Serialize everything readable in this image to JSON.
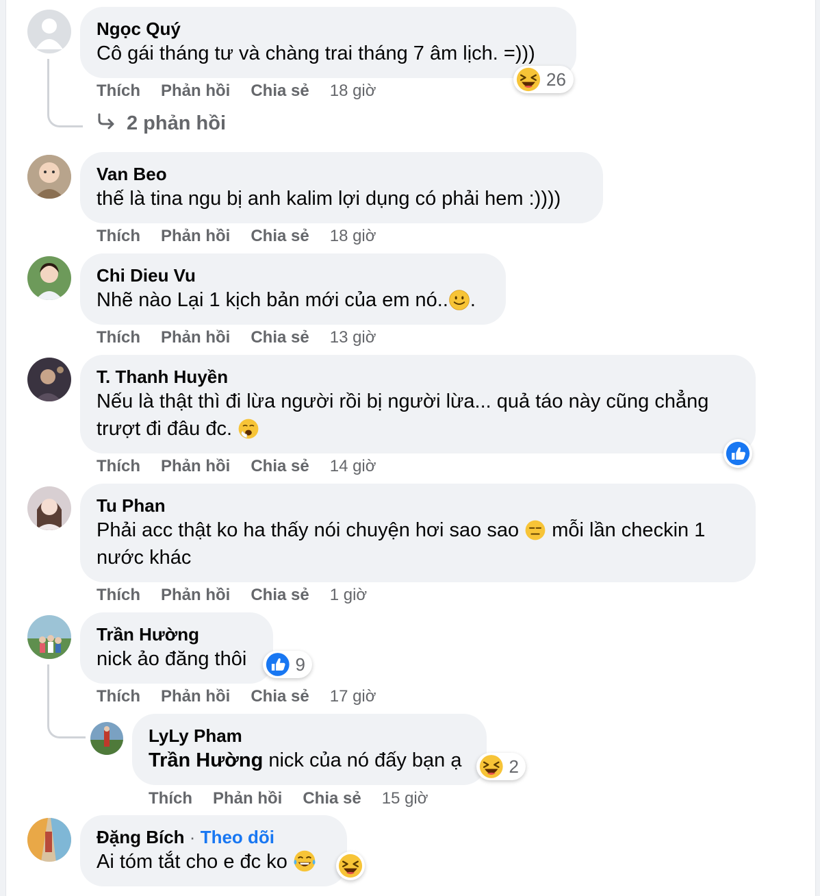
{
  "comments": [
    {
      "author": "Ngọc Quý",
      "text": "Cô gái tháng tư và chàng trai tháng 7 âm lịch. =)))",
      "reaction_count": "26",
      "actions": {
        "like": "Thích",
        "reply": "Phản hồi",
        "share": "Chia sẻ",
        "time": "18 giờ"
      },
      "view_replies": "2 phản hồi"
    },
    {
      "author": "Van Beo",
      "text": "thế là tina ngu bị anh kalim lợi dụng có phải hem :))))",
      "actions": {
        "like": "Thích",
        "reply": "Phản hồi",
        "share": "Chia sẻ",
        "time": "18 giờ"
      }
    },
    {
      "author": "Chi Dieu Vu",
      "text": "Nhẽ nào Lại 1 kịch bản mới của em nó..",
      "text_after_emoji": ".",
      "actions": {
        "like": "Thích",
        "reply": "Phản hồi",
        "share": "Chia sẻ",
        "time": "13 giờ"
      }
    },
    {
      "author": "T. Thanh Huyền",
      "text_line1": "Nếu là thật thì đi lừa người rồi bị người lừa... quả táo này cũng chẳng",
      "text_line2": "trượt đi đâu đc.",
      "actions": {
        "like": "Thích",
        "reply": "Phản hồi",
        "share": "Chia sẻ",
        "time": "14 giờ"
      }
    },
    {
      "author": "Tu Phan",
      "text_line1_a": "Phải acc thật ko ha thấy nói chuyện hơi sao sao",
      "text_line1_b": "mỗi lần checkin 1",
      "text_line2": "nước khác",
      "actions": {
        "like": "Thích",
        "reply": "Phản hồi",
        "share": "Chia sẻ",
        "time": "1 giờ"
      }
    },
    {
      "author": "Trần Hường",
      "text": "nick ảo đăng thôi",
      "reaction_count": "9",
      "actions": {
        "like": "Thích",
        "reply": "Phản hồi",
        "share": "Chia sẻ",
        "time": "17 giờ"
      },
      "reply": {
        "author": "LyLy Pham",
        "mention": "Trần Hường",
        "text": "nick của nó đấy bạn ạ",
        "reaction_count": "2",
        "actions": {
          "like": "Thích",
          "reply": "Phản hồi",
          "share": "Chia sẻ",
          "time": "15 giờ"
        }
      }
    },
    {
      "author": "Đặng Bích",
      "separator": " · ",
      "follow": "Theo dõi",
      "text": "Ai tóm tắt cho e đc ko"
    }
  ],
  "icons": {
    "laugh": "laughing-face-emoji",
    "like": "like-thumbs-up",
    "smile": "smiling-face-emoji",
    "yawn": "yawning-face-emoji",
    "expressionless": "expressionless-face-emoji",
    "tears_of_joy": "face-with-tears-of-joy-emoji",
    "reply_arrow": "reply-arrow-icon"
  },
  "colors": {
    "bubble": "#f0f2f5",
    "like_blue": "#1877f2",
    "secondary_text": "#65676b",
    "follow_link": "#1877f2"
  }
}
